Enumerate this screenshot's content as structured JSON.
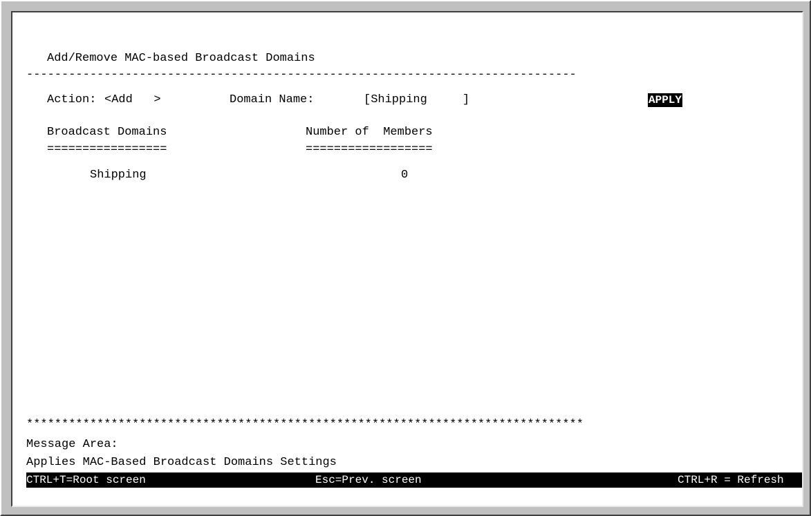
{
  "screen_title": "Add/Remove MAC-based Broadcast Domains",
  "action": {
    "label": "Action:",
    "value": "<Add   >"
  },
  "domain_name": {
    "label": "Domain Name:",
    "value": "[Shipping     ]"
  },
  "apply_label": "APPLY",
  "table": {
    "headers": [
      "Broadcast Domains",
      "Number of  Members"
    ],
    "underline_left": "=================",
    "underline_right": "==================",
    "rows": [
      {
        "domain": "Shipping",
        "members": "0"
      }
    ]
  },
  "separators": {
    "dash_line": "------------------------------------------------------------------------------",
    "star_line": "*******************************************************************************"
  },
  "message": {
    "label": "Message Area:",
    "text": "Applies MAC-Based Broadcast Domains Settings"
  },
  "status": {
    "root": "CTRL+T=Root screen",
    "prev": "Esc=Prev. screen",
    "refresh": "CTRL+R = Refresh"
  }
}
